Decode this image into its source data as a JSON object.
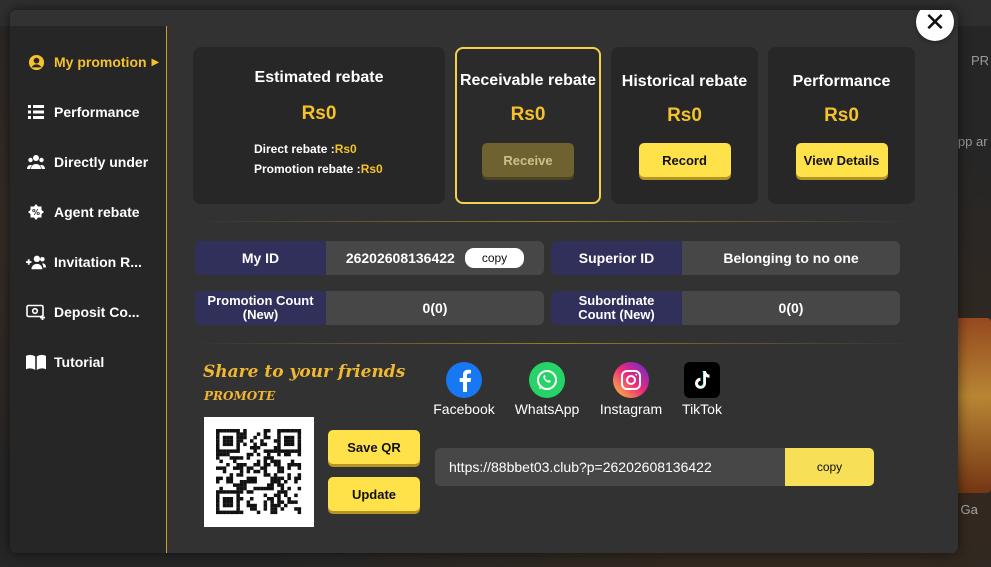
{
  "background": {
    "top_right_text": "PR",
    "side_text": "the app ar",
    "card_label": "ortune Ga"
  },
  "close": {
    "icon": "close-icon"
  },
  "sidebar": {
    "items": [
      {
        "label": "My promotion",
        "icon": "user-circle-icon",
        "active": true
      },
      {
        "label": "Performance",
        "icon": "list-icon"
      },
      {
        "label": "Directly under",
        "icon": "group-icon"
      },
      {
        "label": "Agent rebate",
        "icon": "rebate-badge-icon"
      },
      {
        "label": "Invitation R...",
        "icon": "add-user-icon"
      },
      {
        "label": "Deposit Co...",
        "icon": "deposit-icon"
      },
      {
        "label": "Tutorial",
        "icon": "book-icon"
      }
    ]
  },
  "cards": {
    "estimated": {
      "title": "Estimated rebate",
      "value": "Rs0",
      "direct_label": "Direct rebate :",
      "direct_value": "Rs0",
      "promotion_label": "Promotion rebate :",
      "promotion_value": "Rs0"
    },
    "receivable": {
      "title": "Receivable rebate",
      "value": "Rs0",
      "button": "Receive"
    },
    "historical": {
      "title": "Historical rebate",
      "value": "Rs0",
      "button": "Record"
    },
    "performance": {
      "title": "Performance",
      "value": "Rs0",
      "button": "View Details"
    }
  },
  "info": {
    "my_id_label": "My ID",
    "my_id_value": "26202608136422",
    "copy_label": "copy",
    "superior_label": "Superior ID",
    "superior_value": "Belonging to no one",
    "promotion_count_label_1": "Promotion Count",
    "promotion_count_label_2": "(New)",
    "promotion_count_value": "0(0)",
    "subordinate_label_1": "Subordinate",
    "subordinate_label_2": "Count (New)",
    "subordinate_value": "0(0)"
  },
  "share": {
    "title": "Share to your friends",
    "subtitle": "PROMOTE",
    "socials": [
      {
        "label": "Facebook",
        "icon": "facebook-icon",
        "color": "#1877f2"
      },
      {
        "label": "WhatsApp",
        "icon": "whatsapp-icon",
        "color": "#25d366"
      },
      {
        "label": "Instagram",
        "icon": "instagram-icon",
        "color": "#e1306c"
      },
      {
        "label": "TikTok",
        "icon": "tiktok-icon",
        "color": "#000000"
      }
    ],
    "save_qr": "Save QR",
    "update": "Update",
    "link": "https://88bbet03.club?p=26202608136422",
    "link_copy": "copy"
  },
  "colors": {
    "accent": "#f5c22b",
    "button": "#ffe14a",
    "key_bg": "#30305a"
  }
}
